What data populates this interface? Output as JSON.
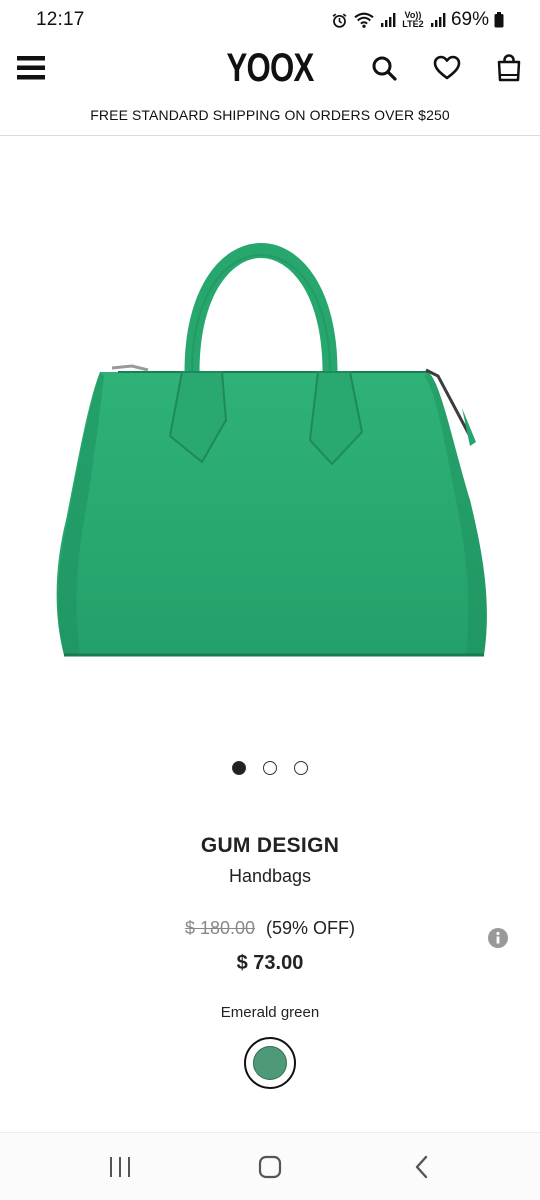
{
  "status_bar": {
    "time": "12:17",
    "battery": "69%",
    "icons": [
      "alarm-icon",
      "wifi-icon",
      "signal-icon",
      "volte-icon",
      "signal-icon",
      "battery-icon"
    ],
    "volte_label": "Vo)) LTE2"
  },
  "header": {
    "logo": "YOOX",
    "icons": [
      "menu-icon",
      "search-icon",
      "heart-icon",
      "shopping-bag-icon"
    ]
  },
  "promo": {
    "text": "FREE STANDARD SHIPPING ON ORDERS OVER $250"
  },
  "gallery": {
    "image_subject": "green-handbag",
    "total_images": 3,
    "active_index": 0
  },
  "product": {
    "brand": "GUM DESIGN",
    "category": "Handbags",
    "original_price": "$ 180.00",
    "discount": "(59% OFF)",
    "price": "$ 73.00",
    "color_name": "Emerald green",
    "swatch_color": "#4e9a78"
  },
  "colors": {
    "bag": "#2bab74",
    "bag_dark": "#1e8f5e",
    "text": "#222222"
  },
  "nav_bar": {
    "icons": [
      "recent-apps-icon",
      "home-icon",
      "back-icon"
    ]
  }
}
